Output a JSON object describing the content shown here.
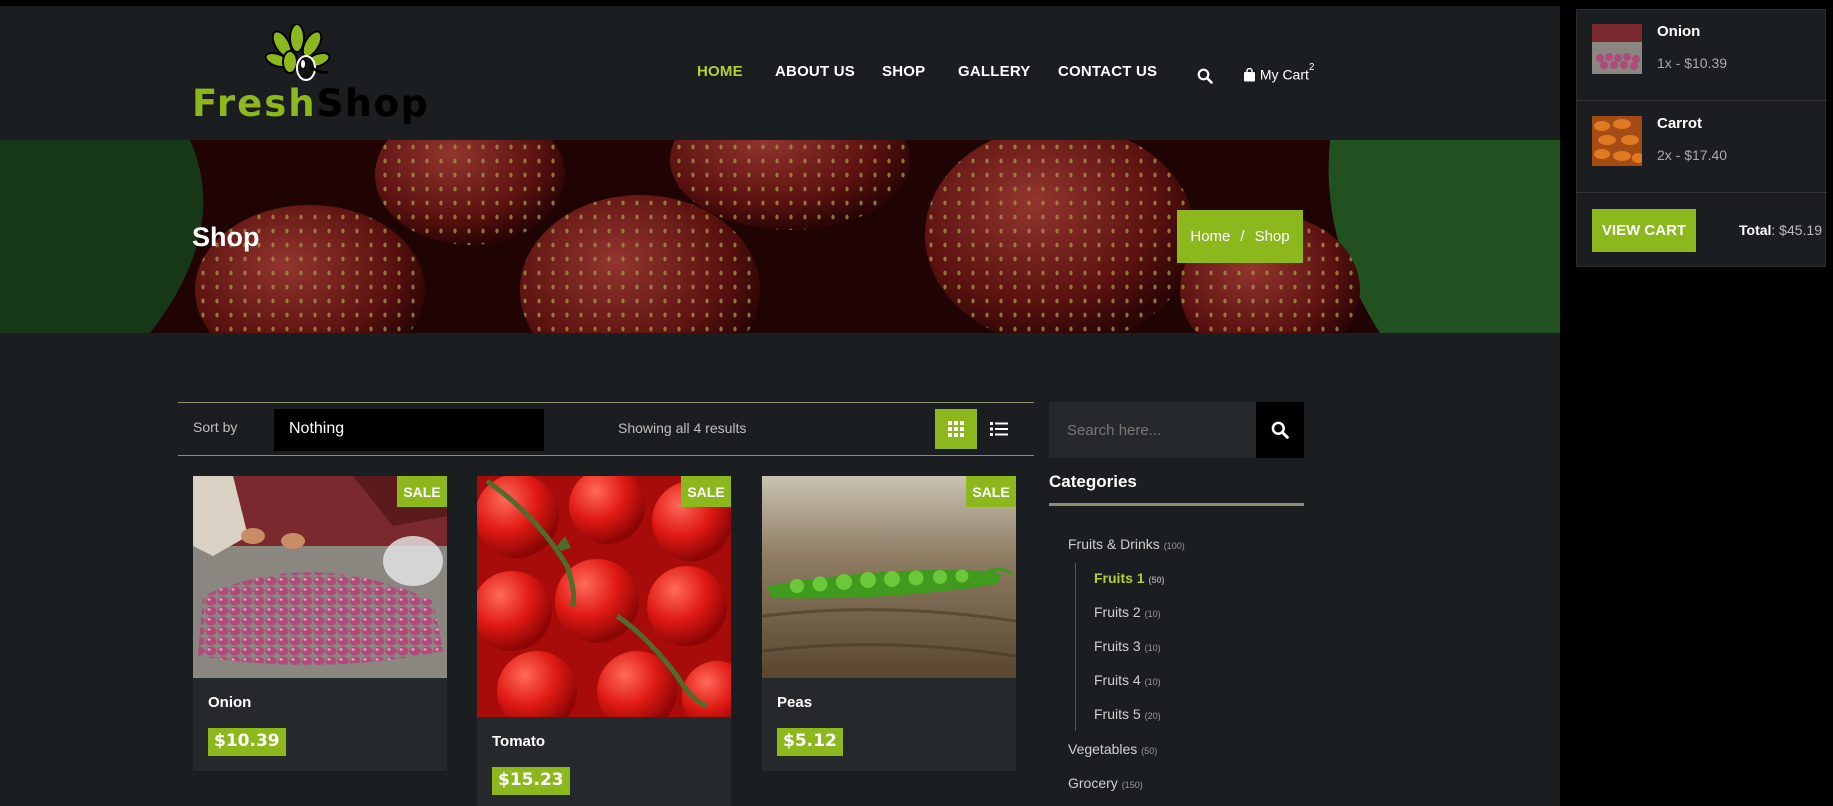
{
  "logo": {
    "fresh": "Fresh",
    "shop": "Shop"
  },
  "nav": {
    "items": [
      {
        "label": "HOME",
        "active": true
      },
      {
        "label": "ABOUT US",
        "active": false
      },
      {
        "label": "SHOP",
        "active": false
      },
      {
        "label": "GALLERY",
        "active": false
      },
      {
        "label": "CONTACT US",
        "active": false
      }
    ],
    "search_icon": "search-icon",
    "cart_label": "My Cart",
    "cart_count": "2"
  },
  "banner": {
    "title": "Shop",
    "breadcrumb": {
      "home": "Home",
      "separator": "/",
      "current": "Shop"
    }
  },
  "toolbar": {
    "sort_label": "Sort by",
    "sort_value": "Nothing",
    "result_count": "Showing all 4 results"
  },
  "products": [
    {
      "name": "Onion",
      "price": "$10.39",
      "badge": "SALE"
    },
    {
      "name": "Tomato",
      "price": "$15.23",
      "badge": "SALE"
    },
    {
      "name": "Peas",
      "price": "$5.12",
      "badge": "SALE"
    }
  ],
  "sidebar": {
    "search_placeholder": "Search here...",
    "categories_title": "Categories",
    "categories": [
      {
        "label": "Fruits & Drinks",
        "count": "(100)"
      },
      {
        "label": "Fruits 1",
        "count": "(50)"
      },
      {
        "label": "Fruits 2",
        "count": "(10)"
      },
      {
        "label": "Fruits 3",
        "count": "(10)"
      },
      {
        "label": "Fruits 4",
        "count": "(10)"
      },
      {
        "label": "Fruits 5",
        "count": "(20)"
      },
      {
        "label": "Vegetables",
        "count": "(50)"
      },
      {
        "label": "Grocery",
        "count": "(150)"
      }
    ]
  },
  "mini_cart": {
    "items": [
      {
        "name": "Onion",
        "qty": "1x - $10.39"
      },
      {
        "name": "Carrot",
        "qty": "2x - $17.40"
      }
    ],
    "view_cart": "VIEW CART",
    "total_label": "Total",
    "total_value": ": $45.19"
  },
  "colors": {
    "accent": "#8cb81e",
    "nav_active": "#b0d134",
    "background": "#1b1e20",
    "card": "#26292b"
  }
}
